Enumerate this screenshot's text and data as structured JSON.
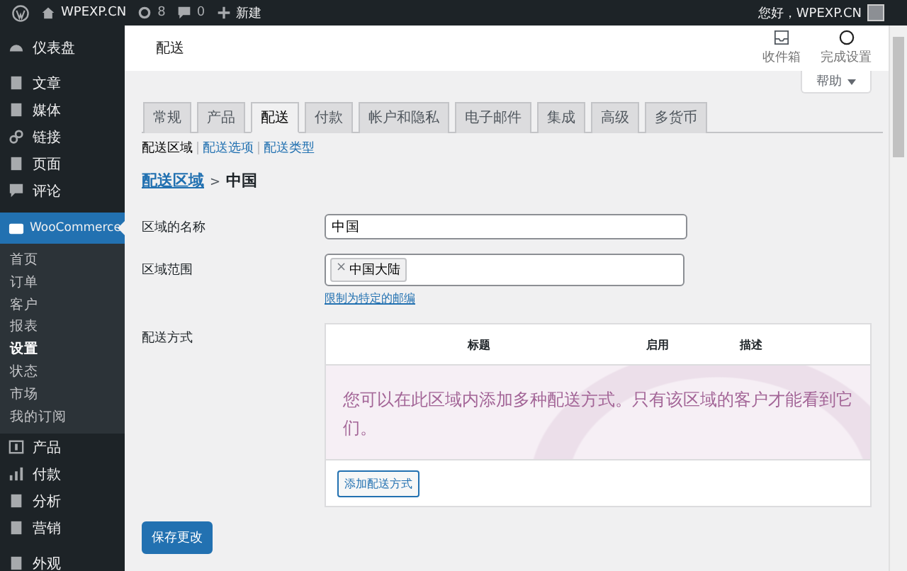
{
  "admin_bar": {
    "site": "WPEXP.CN",
    "updates": "8",
    "comments": "0",
    "new": "新建",
    "greeting": "您好，WPEXP.CN"
  },
  "sidebar": {
    "items": [
      {
        "label": "仪表盘",
        "selected": false
      },
      {
        "label": "文章",
        "selected": false
      },
      {
        "label": "媒体",
        "selected": false
      },
      {
        "label": "链接",
        "selected": false
      },
      {
        "label": "页面",
        "selected": false
      },
      {
        "label": "评论",
        "selected": false
      },
      {
        "label": "WooCommerce",
        "selected": true,
        "children": [
          {
            "label": "首页",
            "selected": false
          },
          {
            "label": "订单",
            "selected": false
          },
          {
            "label": "客户",
            "selected": false
          },
          {
            "label": "报表",
            "selected": false
          },
          {
            "label": "设置",
            "selected": true
          },
          {
            "label": "状态",
            "selected": false
          },
          {
            "label": "市场",
            "selected": false
          },
          {
            "label": "我的订阅",
            "selected": false
          }
        ]
      },
      {
        "label": "产品",
        "selected": false
      },
      {
        "label": "付款",
        "selected": false
      },
      {
        "label": "分析",
        "selected": false
      },
      {
        "label": "营销",
        "selected": false
      },
      {
        "label": "外观",
        "selected": false
      }
    ]
  },
  "header": {
    "title": "配送",
    "actions": [
      {
        "label": "收件箱"
      },
      {
        "label": "完成设置"
      }
    ],
    "help": "帮助"
  },
  "tabs": [
    {
      "label": "常规",
      "selected": false
    },
    {
      "label": "产品",
      "selected": false
    },
    {
      "label": "配送",
      "selected": true
    },
    {
      "label": "付款",
      "selected": false
    },
    {
      "label": "帐户和隐私",
      "selected": false
    },
    {
      "label": "电子邮件",
      "selected": false
    },
    {
      "label": "集成",
      "selected": false
    },
    {
      "label": "高级",
      "selected": false
    },
    {
      "label": "多货币",
      "selected": false
    }
  ],
  "subnav": [
    {
      "label": "配送区域",
      "selected": true
    },
    {
      "label": "配送选项",
      "selected": false
    },
    {
      "label": "配送类型",
      "selected": false
    }
  ],
  "breadcrumb": {
    "link": "配送区域",
    "separator": ">",
    "current": "中国"
  },
  "zone_name": {
    "label": "区域的名称",
    "value": "中国"
  },
  "zone_regions": {
    "label": "区域范围",
    "tags": [
      {
        "remove": "×",
        "label": "中国大陆"
      }
    ],
    "link": "限制为特定的邮编"
  },
  "methods": {
    "label": "配送方式",
    "columns": [
      "标题",
      "启用",
      "描述"
    ],
    "empty_message": "您可以在此区域内添加多种配送方式。只有该区域的客户才能看到它们。",
    "add_button": "添加配送方式"
  },
  "save_button": "保存更改"
}
